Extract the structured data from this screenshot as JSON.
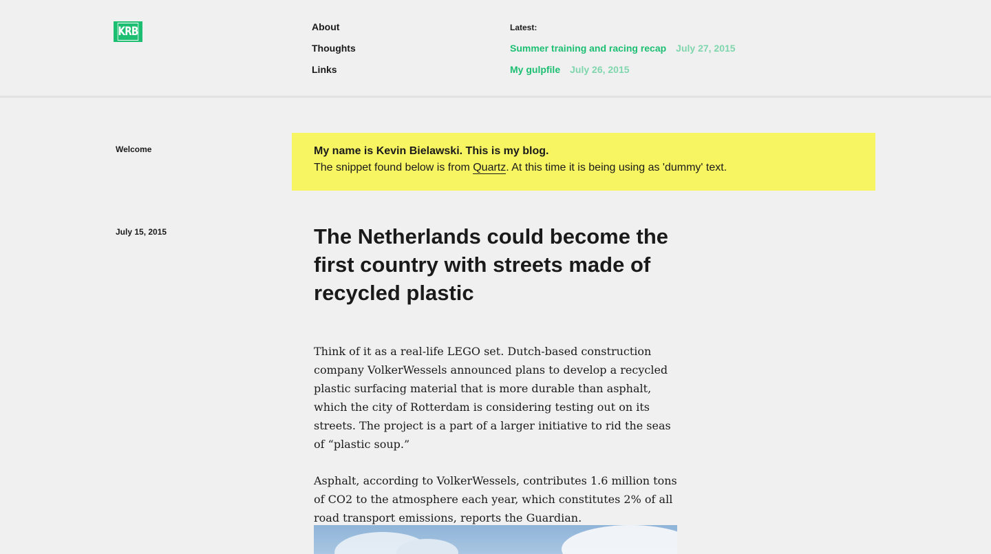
{
  "header": {
    "logo_text": "KRB",
    "nav": [
      {
        "label": "About"
      },
      {
        "label": "Thoughts"
      },
      {
        "label": "Links"
      }
    ],
    "latest": {
      "title": "Latest:",
      "posts": [
        {
          "title": "Summer training and racing recap",
          "date": "July 27, 2015"
        },
        {
          "title": "My gulpfile",
          "date": "July 26, 2015"
        }
      ]
    }
  },
  "welcome": {
    "label": "Welcome",
    "line1": "My name is Kevin Bielawski. This is my blog.",
    "line2_before": "The snippet found below is from ",
    "line2_link": "Quartz",
    "line2_after": ". At this time it is being using as 'dummy' text."
  },
  "article": {
    "date": "July 15, 2015",
    "title": "The Netherlands could become the first country with streets made of recycled plastic",
    "paragraphs": [
      "Think of it as a real-life LEGO set. Dutch-based construction company VolkerWessels announced plans to develop a recycled plastic surfacing material that is more durable than asphalt, which the city of Rotterdam is considering testing out on its streets. The project is a part of a larger initiative to rid the seas of “plastic soup.”",
      "Asphalt, according to VolkerWessels, contributes 1.6 million tons of CO2 to the atmosphere each year, which constitutes 2% of all road transport emissions, reports the Guardian."
    ]
  },
  "colors": {
    "accent": "#1cbf72",
    "accent_light": "#7fd6ad",
    "highlight": "#f8f563",
    "background": "#f0f0f0"
  }
}
